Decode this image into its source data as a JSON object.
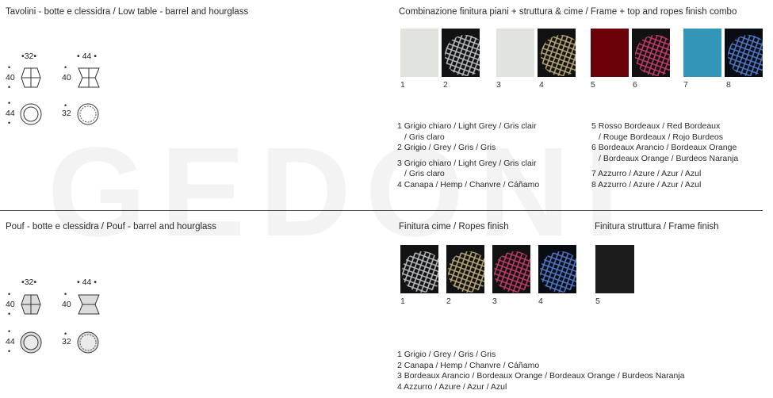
{
  "watermark": "GEDONI",
  "tables": {
    "title": "Tavolini - botte e clessidra / Low table - barrel and hourglass",
    "barrel_width": "32",
    "barrel_height": "40",
    "hourglass_width": "44",
    "hourglass_height": "40",
    "round_large": "44",
    "round_small": "32",
    "icons": [
      "barrel-side-icon",
      "hourglass-side-icon",
      "round-top-icon",
      "round-top-small-icon"
    ]
  },
  "combo": {
    "title": "Combinazione finitura piani + struttura & cime / Frame + top and ropes finish combo",
    "numbers": [
      "1",
      "2",
      "3",
      "4",
      "5",
      "6",
      "7",
      "8"
    ],
    "colors": {
      "light_grey": "#e1e4dc",
      "bordeaux": "#6a0008",
      "azure": "#3196b8",
      "rope_dark": "#121214"
    },
    "legend_left": [
      "1 Grigio chiaro / Light Grey / Gris clair",
      "/ Gris claro",
      "2 Grigio / Grey / Gris / Gris",
      "3 Grigio chiaro / Light Grey / Gris clair",
      "/ Gris claro",
      "4 Canapa / Hemp / Chanvre / Cáñamo"
    ],
    "legend_right": [
      "5 Rosso Bordeaux / Red Bordeaux",
      "/ Rouge Bordeaux / Rojo Burdeos",
      "6 Bordeaux Arancio / Bordeaux Orange",
      "/ Bordeaux Orange / Burdeos Naranja",
      "7 Azzurro / Azure / Azur / Azul",
      "8 Azzurro / Azure / Azur / Azul"
    ]
  },
  "pouf": {
    "title": "Pouf - botte e clessidra / Pouf - barrel and hourglass",
    "barrel_width": "32",
    "barrel_height": "40",
    "hourglass_width": "44",
    "hourglass_height": "40",
    "round_large": "44",
    "round_small": "32"
  },
  "ropes": {
    "title": "Finitura cime / Ropes finish",
    "numbers": [
      "1",
      "2",
      "3",
      "4"
    ],
    "legend": [
      "1 Grigio / Grey / Gris / Gris",
      "2 Canapa / Hemp / Chanvre / Cáñamo",
      "3 Bordeaux Arancio / Bordeaux Orange / Bordeaux Orange / Burdeos Naranja",
      "4 Azzurro / Azure / Azur / Azul"
    ]
  },
  "frame": {
    "title": "Finitura struttura / Frame finish",
    "numbers": [
      "5"
    ],
    "color": "#1c1c1c"
  }
}
